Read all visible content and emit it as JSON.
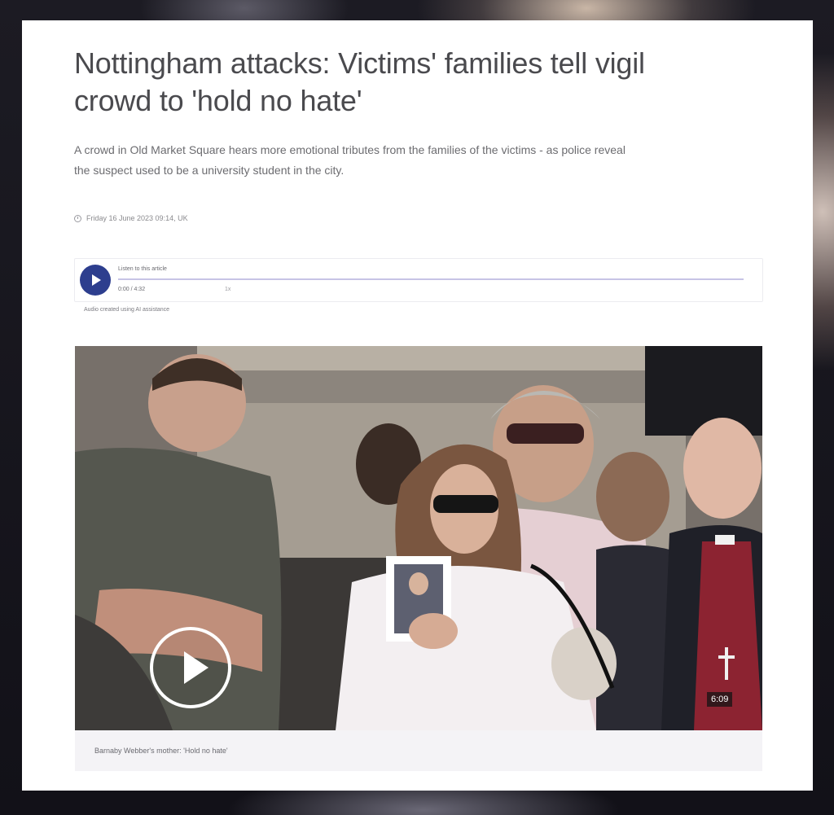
{
  "article": {
    "headline": "Nottingham attacks: Victims' families tell vigil crowd to 'hold no hate'",
    "standfirst": "A crowd in Old Market Square hears more emotional tributes from the families of the victims - as police reveal the suspect used to be a university student in the city.",
    "dateline": "Friday 16 June 2023 09:14, UK"
  },
  "audio_player": {
    "label": "Listen to this article",
    "time": "0:00 / 4:32",
    "speed": "1x",
    "note": "Audio created using AI assistance"
  },
  "video": {
    "duration": "6:09",
    "caption": "Barnaby Webber's mother: 'Hold no hate'",
    "play_icon": "play-circle-icon"
  },
  "colors": {
    "card_background": "#ffffff",
    "audio_accent": "#2d3e8e",
    "headline_text": "#4a4a4e"
  }
}
